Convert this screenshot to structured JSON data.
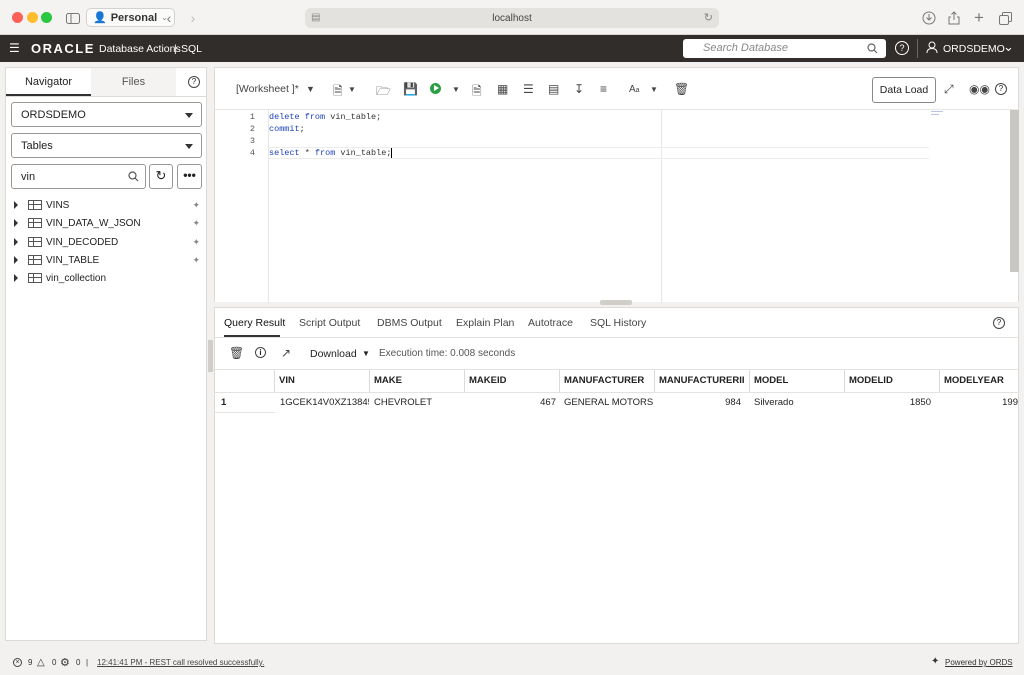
{
  "browser": {
    "profile": "Personal",
    "url": "localhost"
  },
  "app": {
    "brand": "ORACLE",
    "product": "Database Actions",
    "section": "SQL",
    "search_placeholder": "Search Database",
    "user": "ORDSDEMO"
  },
  "navigator": {
    "tabs": [
      "Navigator",
      "Files"
    ],
    "schema": "ORDSDEMO",
    "object_type": "Tables",
    "filter": "vin",
    "items": [
      "VINS",
      "VIN_DATA_W_JSON",
      "VIN_DECODED",
      "VIN_TABLE",
      "vin_collection"
    ]
  },
  "worksheet": {
    "name": "[Worksheet ]*",
    "data_load": "Data Load",
    "line_numbers": [
      "1",
      "2",
      "3",
      "4"
    ]
  },
  "results": {
    "tabs": [
      "Query Result",
      "Script Output",
      "DBMS Output",
      "Explain Plan",
      "Autotrace",
      "SQL History"
    ],
    "download": "Download",
    "exec_time": "Execution time: 0.008 seconds",
    "columns": [
      "VIN",
      "MAKE",
      "MAKEID",
      "MANUFACTURER",
      "MANUFACTURERII",
      "MODEL",
      "MODELID",
      "MODELYEAR"
    ],
    "row_number": "1",
    "row": [
      "1GCEK14V0XZ13845",
      "CHEVROLET",
      "467",
      "GENERAL MOTORS L",
      "984",
      "Silverado",
      "1850",
      "199"
    ]
  },
  "status": {
    "errors": "9",
    "warnings": "0",
    "settings": "0",
    "message": "12:41:41 PM - REST call resolved successfully.",
    "powered": "Powered by ORDS"
  },
  "colors": {
    "header_bg": "#312d2a",
    "run_green": "#2c9f45",
    "keyword_blue": "#1a3fb8"
  }
}
